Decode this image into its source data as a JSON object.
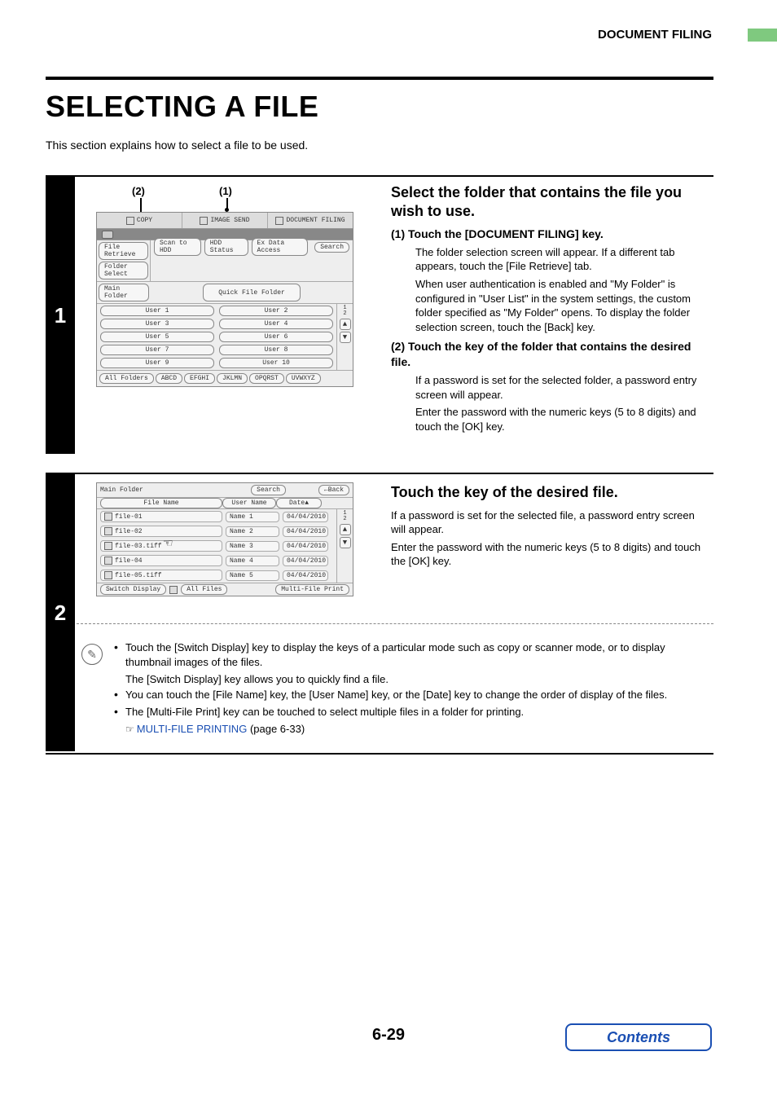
{
  "header": {
    "section": "DOCUMENT FILING"
  },
  "page": {
    "title": "SELECTING A FILE",
    "intro": "This section explains how to select a file to be used.",
    "number": "6-29"
  },
  "callouts": {
    "c1": "(1)",
    "c2": "(2)"
  },
  "panel1": {
    "tabs": {
      "copy": "COPY",
      "imagesend": "IMAGE SEND",
      "docfile": "DOCUMENT FILING"
    },
    "side": {
      "file_retrieve": "File Retrieve",
      "folder_select": "Folder Select"
    },
    "top_btns": {
      "scan": "Scan to HDD",
      "hdd": "HDD Status",
      "ext": "Ex Data Access",
      "search": "Search"
    },
    "main_row": {
      "main": "Main Folder",
      "quick": "Quick File Folder"
    },
    "users": [
      "User 1",
      "User 2",
      "User 3",
      "User 4",
      "User 5",
      "User 6",
      "User 7",
      "User 8",
      "User 9",
      "User 10"
    ],
    "scroll": {
      "frac": "1\n2"
    },
    "bottom": {
      "all": "All Folders",
      "g1": "ABCD",
      "g2": "EFGHI",
      "g3": "JKLMN",
      "g4": "OPQRST",
      "g5": "UVWXYZ"
    }
  },
  "right1": {
    "h": "Select the folder that contains the file you wish to use.",
    "s1_label": "(1)  Touch the [DOCUMENT FILING] key.",
    "s1_p1": "The folder selection screen will appear. If a different tab appears, touch the [File Retrieve] tab.",
    "s1_p2": "When user authentication is enabled and \"My Folder\" is configured in \"User List\" in the system settings, the custom folder specified as \"My Folder\" opens. To display the folder selection screen, touch the [Back] key.",
    "s2_label": "(2)  Touch the key of the folder that contains the desired file.",
    "s2_p1": "If a password is set for the selected folder, a password entry screen will appear.",
    "s2_p2": "Enter the password with the numeric keys (5 to 8 digits) and touch the [OK] key."
  },
  "panel2": {
    "title": "Main Folder",
    "search": "Search",
    "back": "Back",
    "cols": {
      "file": "File Name",
      "user": "User Name",
      "date": "Date"
    },
    "rows": [
      {
        "file": "file-01",
        "user": "Name 1",
        "date": "04/04/2010"
      },
      {
        "file": "file-02",
        "user": "Name 2",
        "date": "04/04/2010"
      },
      {
        "file": "file-03.tiff",
        "user": "Name 3",
        "date": "04/04/2010"
      },
      {
        "file": "file-04",
        "user": "Name 4",
        "date": "04/04/2010"
      },
      {
        "file": "file-05.tiff",
        "user": "Name 5",
        "date": "04/04/2010"
      }
    ],
    "scroll": {
      "frac": "1\n2"
    },
    "bottom": {
      "switch": "Switch Display",
      "all": "All Files",
      "multi": "Multi-File Print"
    }
  },
  "right2": {
    "h": "Touch the key of the desired file.",
    "p1": "If a password is set for the selected file, a password entry screen will appear.",
    "p2": "Enter the password with the numeric keys (5 to 8 digits) and touch the [OK] key."
  },
  "tips": {
    "t1": "Touch the [Switch Display] key to display the keys of a particular mode such as copy or scanner mode, or to display thumbnail images of the files.",
    "t1b": "The [Switch Display] key allows you to quickly find a file.",
    "t2": "You can touch the [File Name] key, the [User Name] key, or the [Date] key to change the order of display of the files.",
    "t3": "The [Multi-File Print] key can be touched to select multiple files in a folder for printing.",
    "link": "MULTI-FILE PRINTING",
    "linkref": "(page 6-33)"
  },
  "contents": "Contents"
}
